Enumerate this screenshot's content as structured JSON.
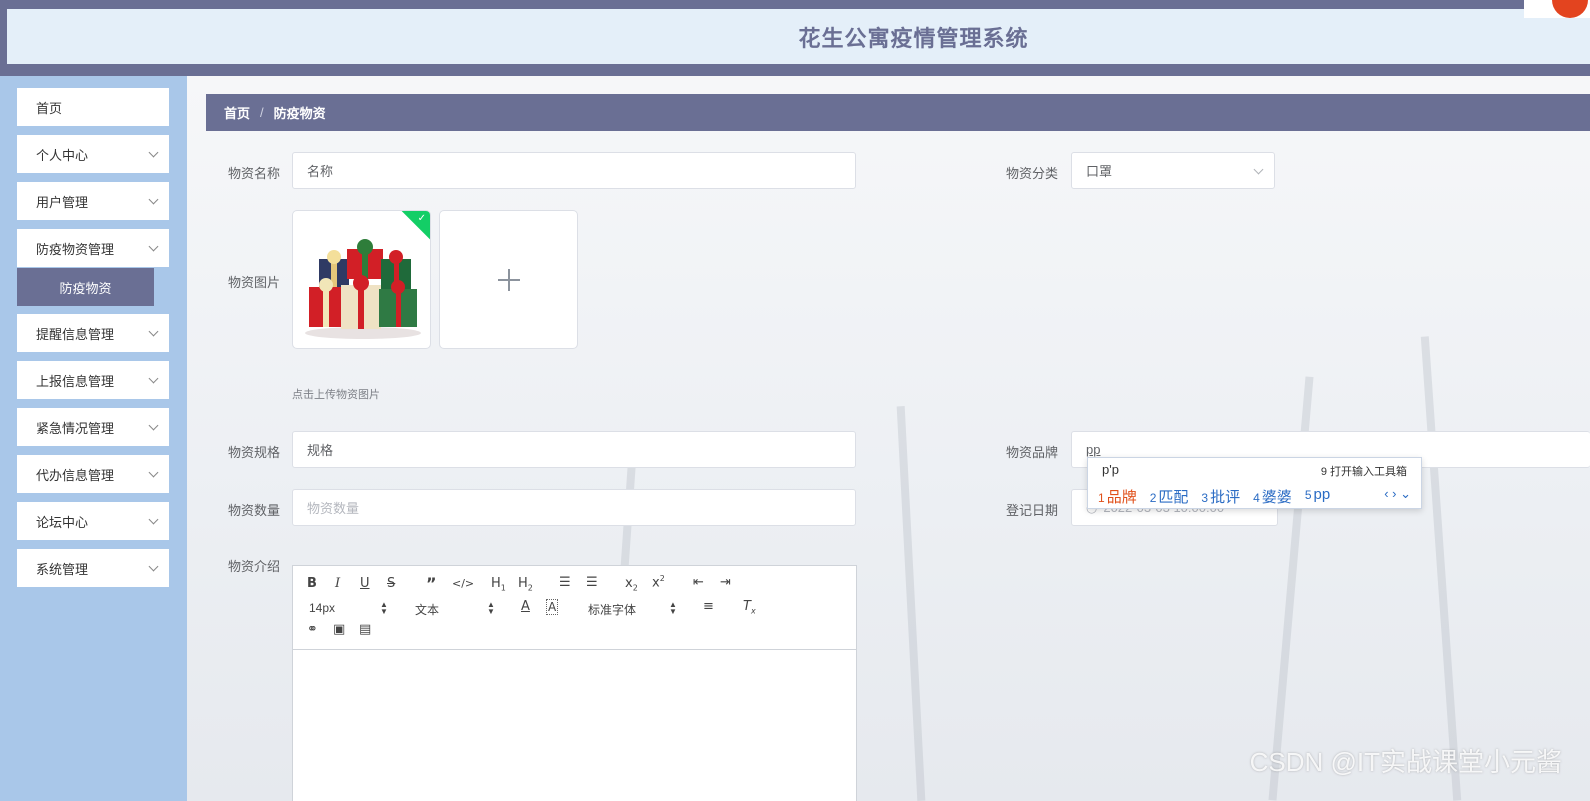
{
  "app": {
    "title": "花生公寓疫情管理系统"
  },
  "sidebar": {
    "items": [
      {
        "label": "首页",
        "has_submenu": false
      },
      {
        "label": "个人中心",
        "has_submenu": true
      },
      {
        "label": "用户管理",
        "has_submenu": true
      },
      {
        "label": "防疫物资管理",
        "has_submenu": true
      },
      {
        "label": "提醒信息管理",
        "has_submenu": true
      },
      {
        "label": "上报信息管理",
        "has_submenu": true
      },
      {
        "label": "紧急情况管理",
        "has_submenu": true
      },
      {
        "label": "代办信息管理",
        "has_submenu": true
      },
      {
        "label": "论坛中心",
        "has_submenu": true
      },
      {
        "label": "系统管理",
        "has_submenu": true
      }
    ],
    "active_sub": "防疫物资"
  },
  "breadcrumb": {
    "home": "首页",
    "separator": "/",
    "current": "防疫物资"
  },
  "form": {
    "name": {
      "label": "物资名称",
      "value": "名称"
    },
    "category": {
      "label": "物资分类",
      "value": "口罩"
    },
    "image": {
      "label": "物资图片",
      "hint": "点击上传物资图片"
    },
    "spec": {
      "label": "物资规格",
      "value": "规格"
    },
    "brand": {
      "label": "物资品牌",
      "value": "pp"
    },
    "quantity": {
      "label": "物资数量",
      "placeholder": "物资数量"
    },
    "date": {
      "label": "登记日期",
      "value": "2022-03-03 10:00:00"
    },
    "intro": {
      "label": "物资介绍"
    }
  },
  "editor": {
    "font_size": "14px",
    "block_format": "文本",
    "font_family": "标准字体",
    "buttons": [
      "bold-icon",
      "italic-icon",
      "underline-icon",
      "strike-icon",
      "quote-icon",
      "code-icon",
      "h1-icon",
      "h2-icon",
      "ordered-list-icon",
      "bullet-list-icon",
      "subscript-icon",
      "superscript-icon",
      "outdent-icon",
      "indent-icon",
      "font-color-icon",
      "background-color-icon",
      "align-icon",
      "clear-format-icon",
      "link-icon",
      "image-icon",
      "video-icon"
    ]
  },
  "ime": {
    "composition": "p'p",
    "tool": "9 打开输入工具箱",
    "candidates": [
      {
        "num": "1",
        "text": "品牌"
      },
      {
        "num": "2",
        "text": "匹配"
      },
      {
        "num": "3",
        "text": "批评"
      },
      {
        "num": "4",
        "text": "婆婆"
      },
      {
        "num": "5",
        "text": "pp"
      }
    ]
  },
  "watermark": "CSDN @IT实战课堂小元酱",
  "colors": {
    "primary": "#6a6f94",
    "sidebar": "#a9c7e9",
    "header_bg": "#e4eff9"
  }
}
